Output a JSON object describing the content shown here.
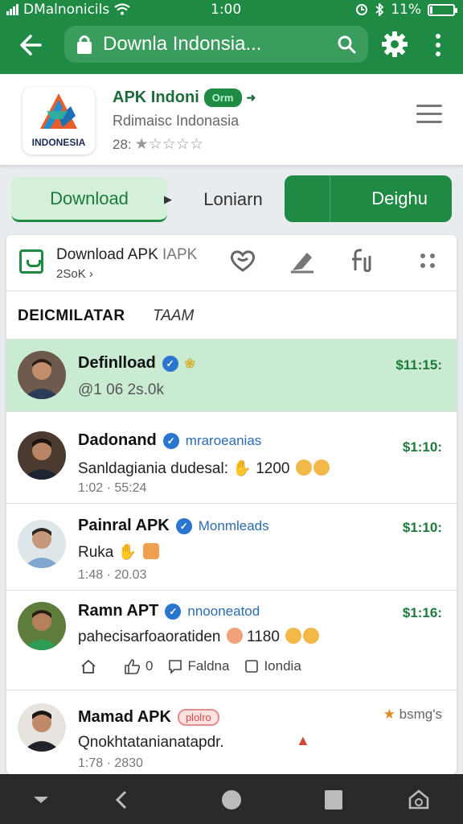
{
  "status_bar": {
    "carrier": "DMalnonicils",
    "time": "1:00",
    "battery": "11%",
    "battery_level": 0.11
  },
  "toolbar": {
    "search_text": "Downla Indonsia...",
    "icons": [
      "back-arrow-icon",
      "lock-icon",
      "search-icon",
      "gear-icon",
      "more-vert-icon"
    ]
  },
  "app": {
    "name": "APK Indoni",
    "badge": "Orm",
    "subtitle": "Rdimaisc Indonasia",
    "rating_count": "28:",
    "rating_stars": 1,
    "logo_text": "INDONESIA"
  },
  "action_buttons": {
    "download": "Download",
    "middle": "Loniarn",
    "right": "Deighu"
  },
  "feed": {
    "header_title": "Download APK",
    "header_title_suffix": "IAPK",
    "header_sub": "2SoK",
    "tab_active": "DEICMILATAR",
    "tab_other": "TAAM",
    "posts": [
      {
        "name": "Definlload",
        "handle": "",
        "message": "@1 06 2s.0k",
        "meta": "",
        "time": "$11:15:",
        "highlighted": true
      },
      {
        "name": "Dadonand",
        "handle": "mraroeanias",
        "message": "Sanldagiania dudesal:",
        "message_number": "1200",
        "meta": "1:02 · 55:24",
        "time": "$1:10:",
        "highlighted": false
      },
      {
        "name": "Painral APK",
        "handle": "Monmleads",
        "message": "Ruka",
        "meta": "1:48 · 20.03",
        "time": "$1:10:",
        "highlighted": false
      },
      {
        "name": "Ramn APT",
        "handle": "nnooneatod",
        "message": "pahecisarfoaoratiden",
        "message_number": "1180",
        "meta": "",
        "time": "$1:16:",
        "highlighted": false,
        "actions": {
          "like_count": "0",
          "reply": "Faldna",
          "share": "Iondia"
        }
      },
      {
        "name": "Mamad APK",
        "pill": "plolro",
        "handle": "",
        "message": "Qnokhtatanianatapdr.",
        "meta": "1:78 · 2830",
        "time": "bsmg's",
        "highlighted": false
      }
    ]
  },
  "colors": {
    "brand_green": "#1e8a44",
    "highlight_row": "#c8ebd2",
    "verified_blue": "#2a76cf"
  }
}
